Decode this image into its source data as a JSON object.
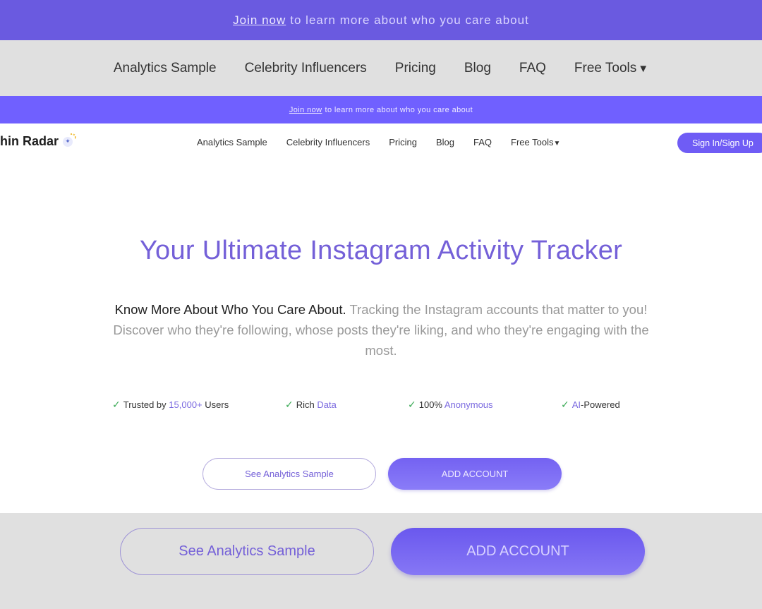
{
  "banner": {
    "link": "Join now",
    "text": "to learn more about who you care about"
  },
  "nav": {
    "items": [
      "Analytics Sample",
      "Celebrity Influencers",
      "Pricing",
      "Blog",
      "FAQ",
      "Free Tools"
    ],
    "caret": "▼"
  },
  "logo": {
    "text": "hin Radar",
    "icon": "radar-logo-icon"
  },
  "signin": "Sign In/Sign Up",
  "hero": {
    "title": "Your Ultimate Instagram Activity Tracker",
    "lead": "Know More About Who You Care About.",
    "desc": "Tracking the Instagram accounts that matter to you! Discover who they're following, whose posts they're liking, and who they're engaging with the most."
  },
  "features": [
    {
      "pre": "Trusted by ",
      "hl": "15,000+",
      "post": " Users"
    },
    {
      "pre": "Rich ",
      "hl": "Data",
      "post": ""
    },
    {
      "pre": "100% ",
      "hl": "Anonymous",
      "post": ""
    },
    {
      "pre": "",
      "hl": "AI",
      "post": "-Powered"
    }
  ],
  "check_icon": "✓",
  "buttons": {
    "analytics": "See Analytics Sample",
    "add": "ADD ACCOUNT"
  },
  "colors": {
    "accent": "#7460d8",
    "banner": "#6a5ae0",
    "check": "#3aaa55"
  }
}
